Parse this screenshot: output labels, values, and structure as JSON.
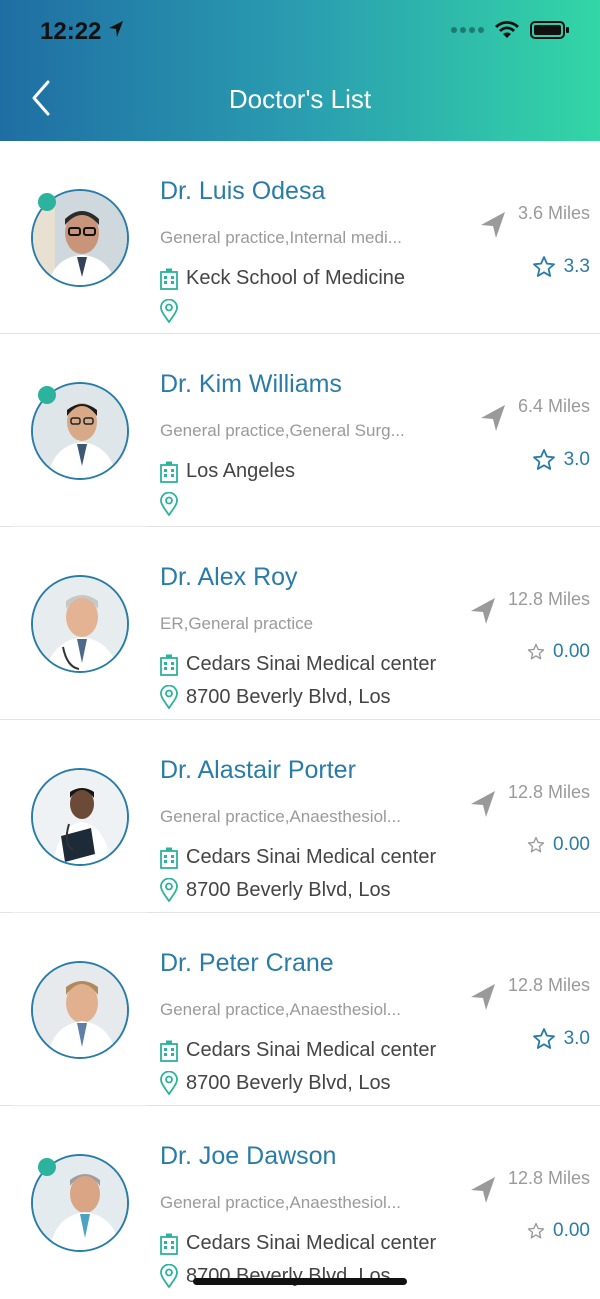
{
  "status_bar": {
    "time": "12:22"
  },
  "header": {
    "title": "Doctor's List"
  },
  "doctors": [
    {
      "name": "Dr. Luis Odesa",
      "specialty": "General practice,Internal medi...",
      "hospital": "Keck School of Medicine",
      "address": "",
      "distance": "3.6 Miles",
      "rating": "3.3",
      "online": true,
      "rated": true
    },
    {
      "name": "Dr. Kim Williams",
      "specialty": "General practice,General Surg...",
      "hospital": "Los Angeles",
      "address": "",
      "distance": "6.4 Miles",
      "rating": "3.0",
      "online": true,
      "rated": true
    },
    {
      "name": "Dr. Alex Roy",
      "specialty": "ER,General practice",
      "hospital": "Cedars Sinai Medical center",
      "address": "8700 Beverly Blvd, Los",
      "distance": "12.8 Miles",
      "rating": "0.00",
      "online": false,
      "rated": false
    },
    {
      "name": "Dr. Alastair Porter",
      "specialty": "General practice,Anaesthesiol...",
      "hospital": "Cedars Sinai Medical center",
      "address": "8700 Beverly Blvd, Los",
      "distance": "12.8 Miles",
      "rating": "0.00",
      "online": false,
      "rated": false
    },
    {
      "name": "Dr. Peter Crane",
      "specialty": "General practice,Anaesthesiol...",
      "hospital": "Cedars Sinai Medical center",
      "address": "8700 Beverly Blvd, Los",
      "distance": "12.8 Miles",
      "rating": "3.0",
      "online": false,
      "rated": true
    },
    {
      "name": "Dr. Joe Dawson",
      "specialty": "General practice,Anaesthesiol...",
      "hospital": "Cedars Sinai Medical center",
      "address": "8700 Beverly Blvd, Los",
      "distance": "12.8 Miles",
      "rating": "0.00",
      "online": true,
      "rated": false
    }
  ],
  "colors": {
    "accent": "#2a7ca8",
    "online": "#2bb39d",
    "muted": "#9a9a9a"
  }
}
